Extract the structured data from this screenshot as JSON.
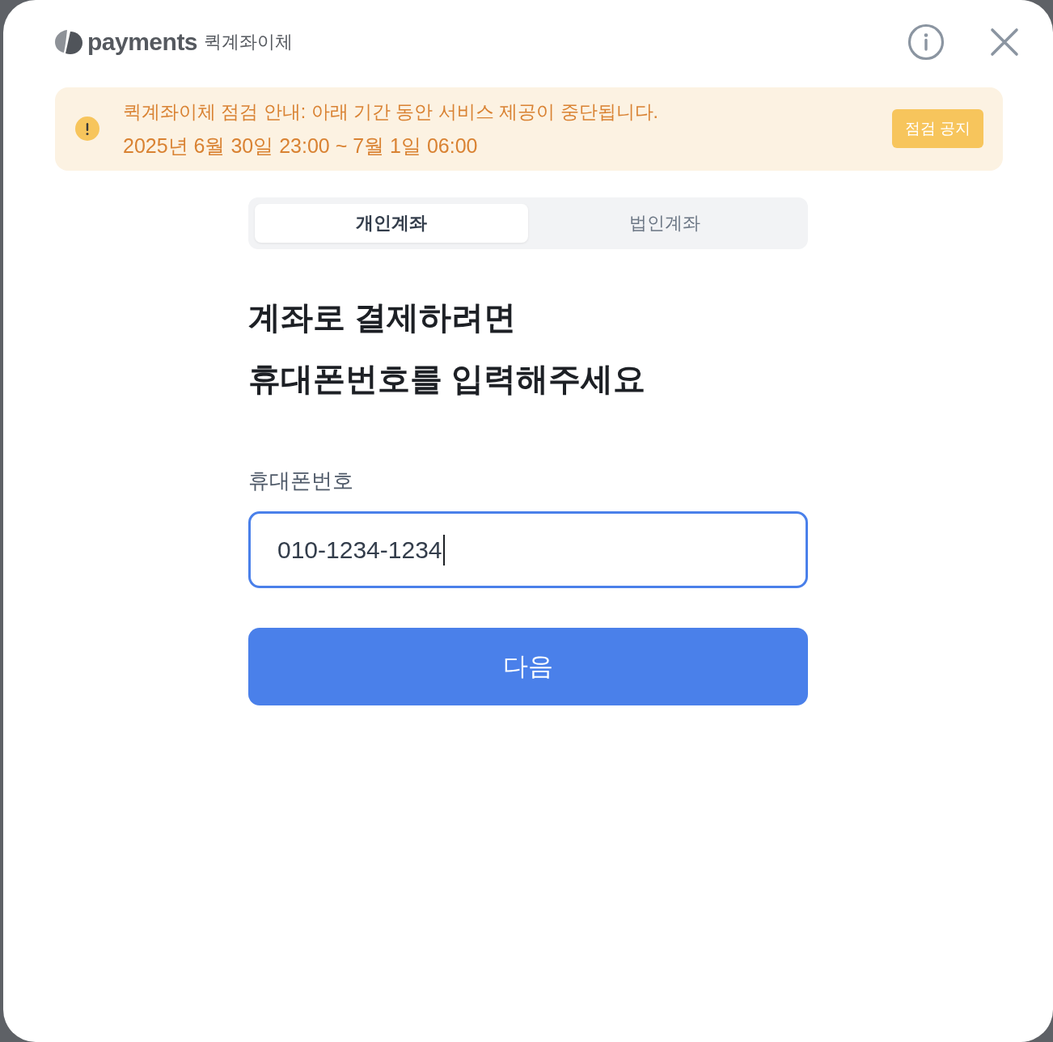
{
  "header": {
    "logo": {
      "wordmark": "payments",
      "product": "퀵계좌이체"
    }
  },
  "notice": {
    "title": "퀵계좌이체 점검 안내: 아래 기간 동안 서비스 제공이 중단됩니다.",
    "period": "2025년 6월 30일 23:00 ~ 7월 1일 06:00",
    "button": "점검 공지"
  },
  "tabs": [
    {
      "label": "개인계좌",
      "selected": true
    },
    {
      "label": "법인계좌",
      "selected": false
    }
  ],
  "heading": [
    "계좌로 결제하려면",
    "휴대폰번호를 입력해주세요"
  ],
  "phone_field": {
    "label": "휴대폰번호",
    "value": "010-1234-1234",
    "focused": true
  },
  "next_button": "다음"
}
